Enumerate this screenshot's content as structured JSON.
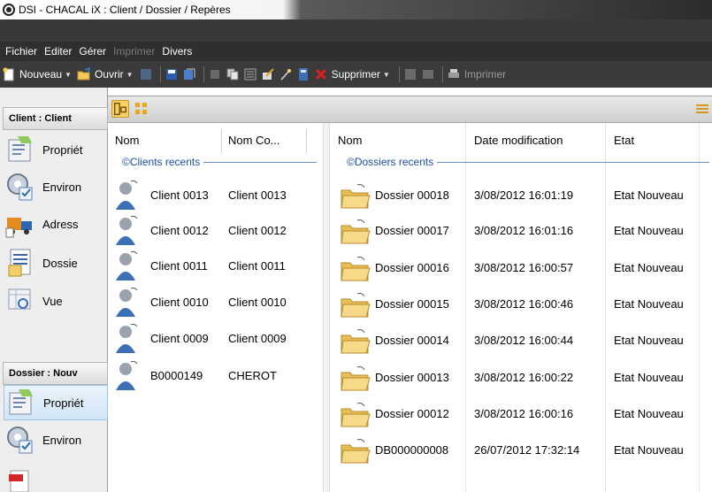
{
  "window": {
    "title": "DSI - CHACAL iX : Client / Dossier / Repères"
  },
  "menu": {
    "items": [
      {
        "label": "Fichier",
        "enabled": true
      },
      {
        "label": "Editer",
        "enabled": true
      },
      {
        "label": "Gérer",
        "enabled": true
      },
      {
        "label": "Imprimer",
        "enabled": false
      },
      {
        "label": "Divers",
        "enabled": true
      }
    ]
  },
  "toolbar": {
    "new_label": "Nouveau",
    "open_label": "Ouvrir",
    "delete_label": "Supprimer",
    "print_label": "Imprimer"
  },
  "sidebar": {
    "client_header": "Client : Client",
    "client_items": [
      {
        "label": "Propriét",
        "icon": "properties-icon"
      },
      {
        "label": "Environ",
        "icon": "environment-icon"
      },
      {
        "label": "Adress",
        "icon": "address-truck-icon"
      },
      {
        "label": "Dossie",
        "icon": "folder-list-icon"
      },
      {
        "label": "Vue",
        "icon": "view-icon"
      }
    ],
    "dossier_header": "Dossier : Nouv",
    "dossier_items": [
      {
        "label": "Propriét",
        "icon": "properties-icon"
      },
      {
        "label": "Environ",
        "icon": "environment-icon"
      },
      {
        "label": "",
        "icon": "pdf-icon"
      }
    ]
  },
  "clients": {
    "headers": [
      "Nom",
      "Nom Co..."
    ],
    "group_label": "©Clients recents",
    "rows": [
      {
        "nom": "Client 0013",
        "nom_complet": "Client 0013"
      },
      {
        "nom": "Client 0012",
        "nom_complet": "Client 0012"
      },
      {
        "nom": "Client 0011",
        "nom_complet": "Client 0011"
      },
      {
        "nom": "Client 0010",
        "nom_complet": "Client 0010"
      },
      {
        "nom": "Client 0009",
        "nom_complet": "Client 0009"
      },
      {
        "nom": "B0000149",
        "nom_complet": "CHEROT"
      }
    ]
  },
  "dossiers": {
    "headers": [
      "Nom",
      "Date modification",
      "Etat"
    ],
    "group_label": "©Dossiers recents",
    "rows": [
      {
        "nom": "Dossier 00018",
        "date": "3/08/2012 16:01:19",
        "etat": "Etat Nouveau"
      },
      {
        "nom": "Dossier 00017",
        "date": "3/08/2012 16:01:16",
        "etat": "Etat Nouveau"
      },
      {
        "nom": "Dossier 00016",
        "date": "3/08/2012 16:00:57",
        "etat": "Etat Nouveau"
      },
      {
        "nom": "Dossier 00015",
        "date": "3/08/2012 16:00:46",
        "etat": "Etat Nouveau"
      },
      {
        "nom": "Dossier 00014",
        "date": "3/08/2012 16:00:44",
        "etat": "Etat Nouveau"
      },
      {
        "nom": "Dossier 00013",
        "date": "3/08/2012 16:00:22",
        "etat": "Etat Nouveau"
      },
      {
        "nom": "Dossier 00012",
        "date": "3/08/2012 16:00:16",
        "etat": "Etat Nouveau"
      },
      {
        "nom": "DB000000008",
        "date": "26/07/2012 17:32:14",
        "etat": "Etat Nouveau"
      }
    ]
  }
}
